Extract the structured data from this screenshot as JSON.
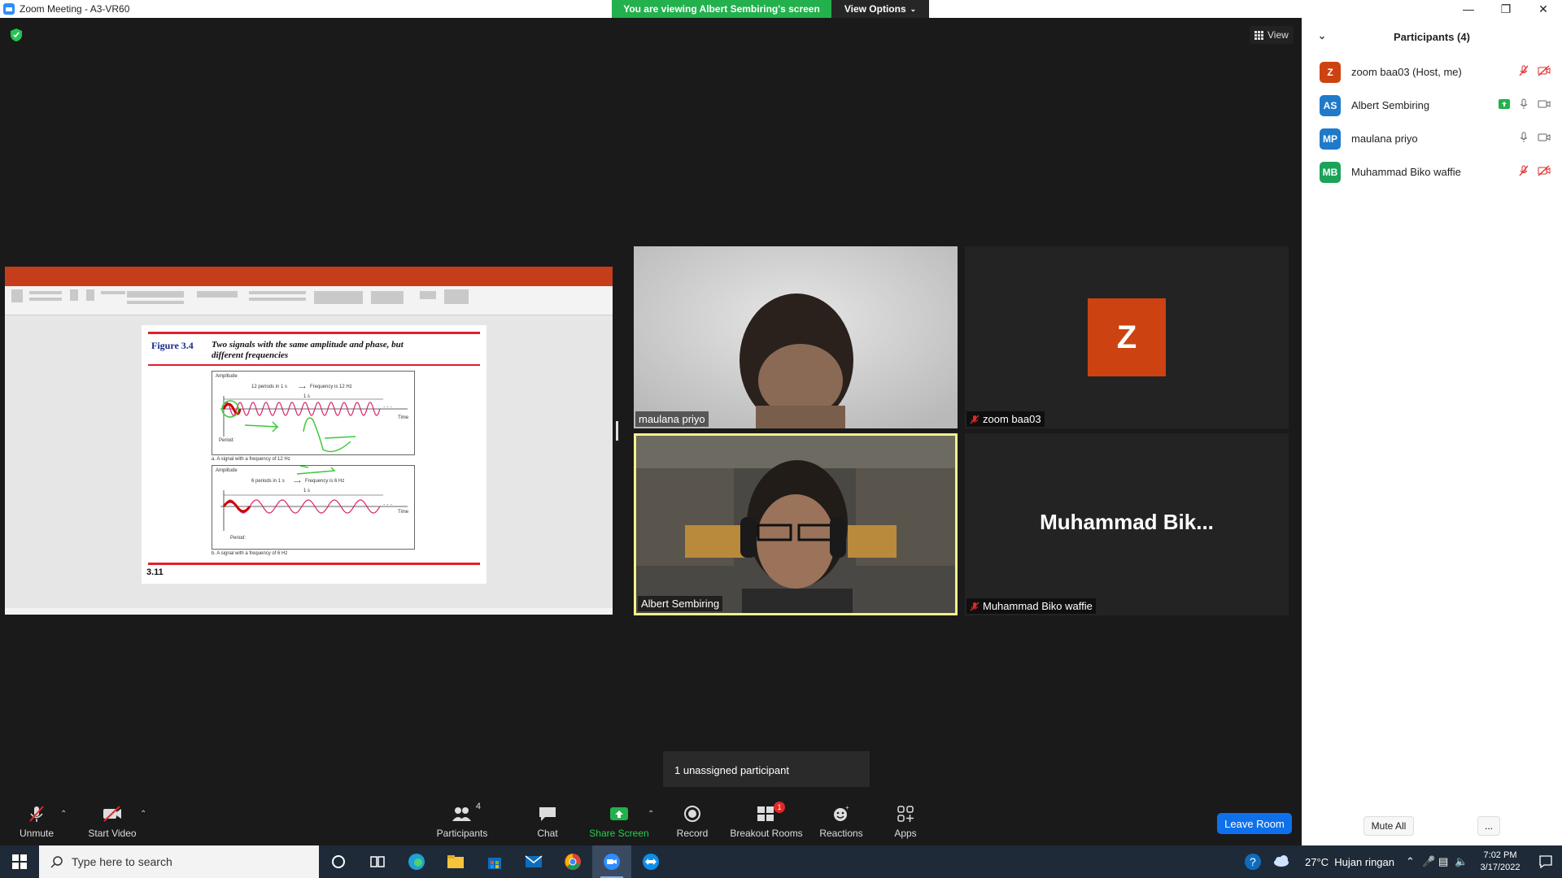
{
  "window": {
    "title": "Zoom Meeting - A3-VR60",
    "banner_text": "You are viewing Albert Sembiring's screen",
    "view_options_label": "View Options",
    "view_label": "View"
  },
  "shared_screen": {
    "figure_label": "Figure 3.4",
    "figure_title": "Two signals with the same amplitude and phase, but different frequencies",
    "signal_a": {
      "axis_label": "Amplitude",
      "periods_text": "12 periods in 1 s",
      "frequency_text": "Frequency is 12 Hz",
      "duration": "1 s",
      "time_label": "Time",
      "period_label": "Period:",
      "caption": "a. A signal with a frequency of 12 Hz"
    },
    "signal_b": {
      "axis_label": "Amplitude",
      "periods_text": "6 periods in 1 s",
      "frequency_text": "Frequency is 6 Hz",
      "duration": "1 s",
      "time_label": "Time",
      "period_label": "Period:",
      "caption": "b. A signal with a frequency of 6 Hz"
    },
    "slide_number": "3.11"
  },
  "tiles": [
    {
      "name": "maulana priyo",
      "muted": false
    },
    {
      "name": "zoom baa03",
      "muted": true,
      "avatar": "Z"
    },
    {
      "name": "Albert Sembiring",
      "muted": false
    },
    {
      "name": "Muhammad Biko waffie",
      "muted": true,
      "display_name": "Muhammad  Bik..."
    }
  ],
  "unassigned_popup": "1 unassigned participant",
  "toolbar": {
    "unmute": "Unmute",
    "start_video": "Start Video",
    "participants": "Participants",
    "participants_count": "4",
    "chat": "Chat",
    "share_screen": "Share Screen",
    "record": "Record",
    "breakout_rooms": "Breakout Rooms",
    "breakout_badge": "1",
    "reactions": "Reactions",
    "apps": "Apps",
    "leave_room": "Leave Room"
  },
  "participants_panel": {
    "title": "Participants (4)",
    "items": [
      {
        "initials": "Z",
        "name": "zoom baa03 (Host, me)",
        "color": "#cc4311"
      },
      {
        "initials": "AS",
        "name": "Albert Sembiring",
        "color": "#1f7ac9"
      },
      {
        "initials": "MP",
        "name": "maulana priyo",
        "color": "#1f7ac9"
      },
      {
        "initials": "MB",
        "name": "Muhammad Biko waffie",
        "color": "#1ca35a"
      }
    ],
    "mute_all": "Mute All",
    "more": "..."
  },
  "taskbar": {
    "search_placeholder": "Type here to search",
    "weather": "27°C  Hujan ringan",
    "time": "7:02 PM",
    "date": "3/17/2022"
  },
  "colors": {
    "zoom_blue": "#0e71eb",
    "share_green": "#22b14c",
    "mute_red": "#e02828",
    "active_speaker": "#f2f28a"
  }
}
